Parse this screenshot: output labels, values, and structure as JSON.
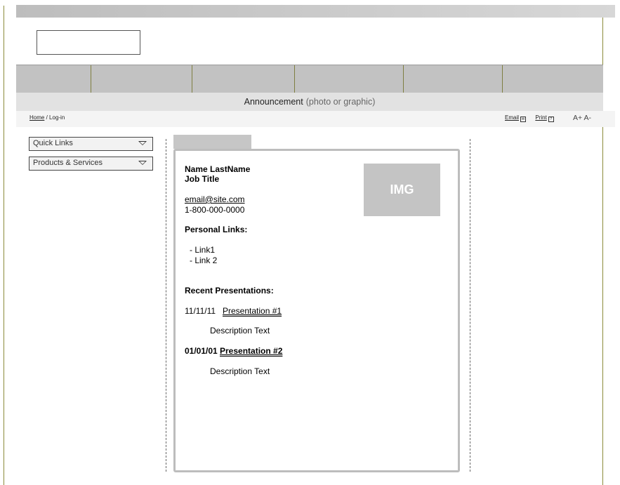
{
  "announcement": {
    "main": "Announcement",
    "sub": "(photo or graphic)"
  },
  "breadcrumb": {
    "home": "Home",
    "sep": "/",
    "current": "Log-in"
  },
  "tools": {
    "email": "Email",
    "print": "Print",
    "font_larger": "A+",
    "font_smaller": "A-"
  },
  "sidebar": {
    "quick_links": "Quick Links",
    "products_services": "Products & Services"
  },
  "profile": {
    "name": "Name LastName",
    "job_title": "Job Title",
    "email": "email@site.com",
    "phone": "1-800-000-0000",
    "image_placeholder": "IMG",
    "personal_links_heading": "Personal Links:",
    "personal_links": [
      "- Link1",
      "- Link 2"
    ],
    "presentations_heading": "Recent Presentations:",
    "presentations": [
      {
        "date": "11/11/11",
        "title": "Presentation #1",
        "description": "Description Text"
      },
      {
        "date": "01/01/01",
        "title": "Presentation #2",
        "description": "Description Text"
      }
    ]
  },
  "nav": {
    "item_count": 6
  }
}
